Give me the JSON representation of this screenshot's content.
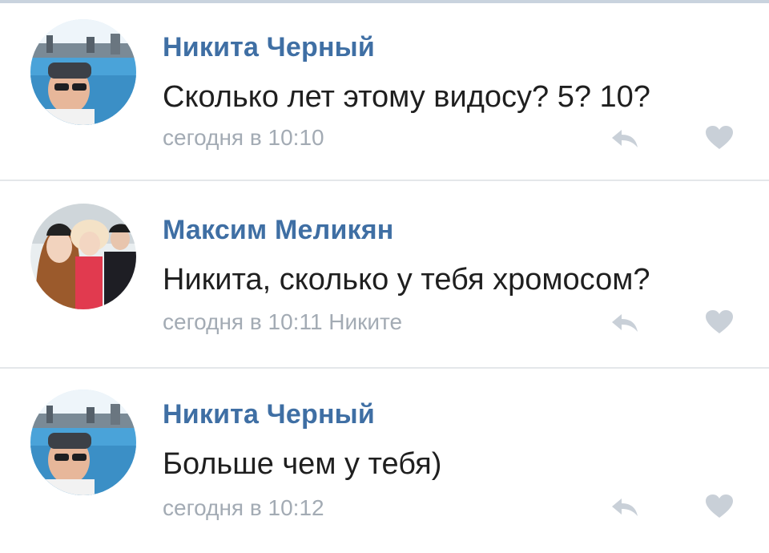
{
  "comments": [
    {
      "author": "Никита Черный",
      "text": "Сколько лет этому видосу? 5? 10?",
      "meta": "сегодня в 10:10"
    },
    {
      "author": "Максим Меликян",
      "text": "Никита, сколько у тебя хромосом?",
      "meta": "сегодня в 10:11 Никите"
    },
    {
      "author": "Никита Черный",
      "text": "Больше чем у тебя)",
      "meta": "сегодня в 10:12"
    }
  ],
  "colors": {
    "author": "#3f6fa4",
    "text": "#1f1f1f",
    "meta": "#a3abb4",
    "icon": "#c9d0d8",
    "divider": "#e4e7ea"
  },
  "icons": {
    "reply": "reply-icon",
    "like": "heart-icon"
  }
}
